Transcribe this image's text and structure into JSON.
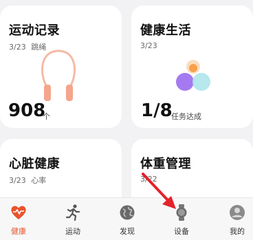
{
  "cards": {
    "exercise": {
      "title": "运动记录",
      "date": "3/23",
      "activity": "跳绳",
      "value": "908",
      "unit": "个"
    },
    "health_life": {
      "title": "健康生活",
      "date": "3/23",
      "value": "1/8",
      "unit": "任务达成"
    },
    "heart": {
      "title": "心脏健康",
      "date": "3/23",
      "metric": "心率"
    },
    "weight": {
      "title": "体重管理",
      "date": "3/22"
    }
  },
  "tabbar": {
    "items": [
      {
        "label": "健康",
        "icon": "heart-pulse-icon",
        "active": true
      },
      {
        "label": "运动",
        "icon": "running-person-icon",
        "active": false
      },
      {
        "label": "发现",
        "icon": "globe-icon",
        "active": false
      },
      {
        "label": "设备",
        "icon": "watch-icon",
        "active": false
      },
      {
        "label": "我的",
        "icon": "person-icon",
        "active": false
      }
    ]
  },
  "colors": {
    "accent": "#e8542d",
    "annotation_arrow": "#e3222b"
  }
}
